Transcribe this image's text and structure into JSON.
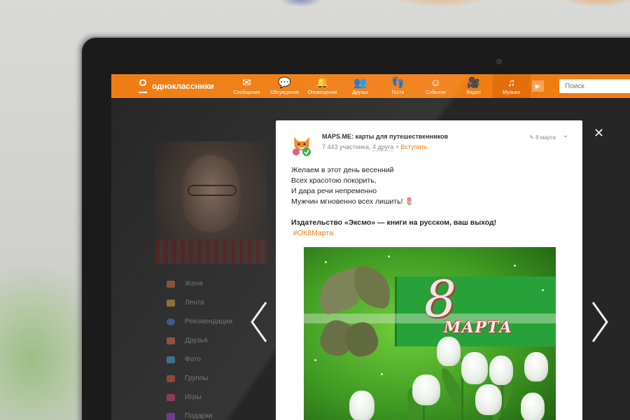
{
  "toolbar": {
    "logo_text": "одноклассники",
    "nav": [
      {
        "label": "Сообщения",
        "icon": "envelope-icon",
        "glyph": "✉"
      },
      {
        "label": "Обсуждения",
        "icon": "chat-bubbles-icon",
        "glyph": "💬"
      },
      {
        "label": "Оповещения",
        "icon": "bell-icon",
        "glyph": "🔔"
      },
      {
        "label": "Друзья",
        "icon": "friends-icon",
        "glyph": "👥"
      },
      {
        "label": "Гости",
        "icon": "footprints-icon",
        "glyph": "👣"
      },
      {
        "label": "События",
        "icon": "events-icon",
        "glyph": "☺"
      },
      {
        "label": "Видео",
        "icon": "video-camera-icon",
        "glyph": "🎥"
      },
      {
        "label": "Музыка",
        "icon": "music-note-icon",
        "glyph": "♫"
      }
    ],
    "search_placeholder": "Поиск"
  },
  "sidebar": {
    "items": [
      {
        "label": "Женя",
        "color": "#d96a3a"
      },
      {
        "label": "Лента",
        "color": "#d9a13a"
      },
      {
        "label": "Рекомендации",
        "color": "#3a7bd9"
      },
      {
        "label": "Друзья",
        "color": "#d96a3a"
      },
      {
        "label": "Фото",
        "color": "#3aa0d9"
      },
      {
        "label": "Группы",
        "color": "#d94a3a"
      },
      {
        "label": "Игры",
        "color": "#d93a6a"
      },
      {
        "label": "Подарки",
        "color": "#9a3ad9"
      }
    ]
  },
  "post": {
    "group_name": "MAPS.ME: карты для путешественников",
    "members": "7 443 участника,",
    "friends": "4 друга",
    "join_label": "Вступить",
    "date": "8 марта",
    "lines": [
      "Желаем в этот день весенний",
      "Всех красотою покорить,",
      "И дара речи непременно",
      "Мужчин мгновенно всех лишить!"
    ],
    "emoji": "🌷",
    "promo": "Издательство «Эксмо» — книги на русском,   ваш выход!",
    "hashtag": "#ОК8Марта",
    "image_text_number": "8",
    "image_text_word": "МАРТА"
  },
  "accent_color": "#f07d13"
}
